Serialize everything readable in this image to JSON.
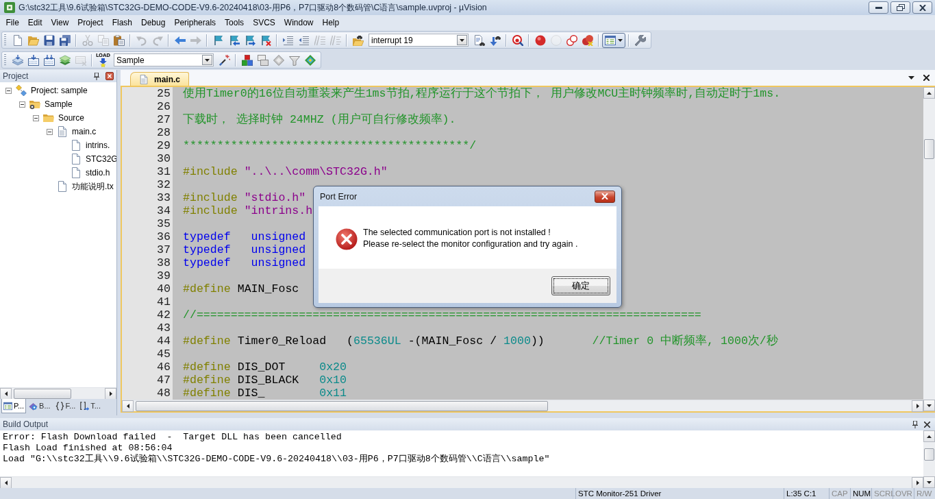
{
  "window": {
    "title": "G:\\stc32工具\\9.6试验箱\\STC32G-DEMO-CODE-V9.6-20240418\\03-用P6，P7口驱动8个数码管\\C语言\\sample.uvproj - µVision"
  },
  "menu": [
    "File",
    "Edit",
    "View",
    "Project",
    "Flash",
    "Debug",
    "Peripherals",
    "Tools",
    "SVCS",
    "Window",
    "Help"
  ],
  "toolbars": [
    {
      "items": [
        {
          "kind": "button",
          "disabled": false,
          "pressed": false
        },
        {
          "kind": "button",
          "disabled": false,
          "pressed": false
        },
        {
          "kind": "button",
          "disabled": false,
          "pressed": false
        },
        {
          "kind": "button",
          "disabled": false,
          "pressed": false
        },
        {
          "kind": "separator"
        },
        {
          "kind": "button",
          "disabled": true,
          "pressed": false
        },
        {
          "kind": "button",
          "disabled": true,
          "pressed": false
        },
        {
          "kind": "button",
          "disabled": false,
          "pressed": false
        },
        {
          "kind": "separator"
        },
        {
          "kind": "button",
          "disabled": true,
          "pressed": false
        },
        {
          "kind": "button",
          "disabled": true,
          "pressed": false
        },
        {
          "kind": "separator"
        },
        {
          "kind": "button",
          "disabled": false,
          "pressed": false
        },
        {
          "kind": "button",
          "disabled": true,
          "pressed": false
        },
        {
          "kind": "separator"
        },
        {
          "kind": "button",
          "disabled": false,
          "pressed": false
        },
        {
          "kind": "button",
          "disabled": false,
          "pressed": false
        },
        {
          "kind": "button",
          "disabled": false,
          "pressed": false
        },
        {
          "kind": "button",
          "disabled": false,
          "pressed": false
        },
        {
          "kind": "separator"
        },
        {
          "kind": "button",
          "disabled": false,
          "pressed": false
        },
        {
          "kind": "button",
          "disabled": false,
          "pressed": false
        },
        {
          "kind": "button",
          "disabled": true,
          "pressed": false
        },
        {
          "kind": "button",
          "disabled": true,
          "pressed": false
        },
        {
          "kind": "separator"
        },
        {
          "kind": "button",
          "disabled": false,
          "pressed": false
        },
        {
          "kind": "combo",
          "value": "interrupt 19"
        },
        {
          "kind": "button",
          "disabled": false,
          "pressed": false
        },
        {
          "kind": "button",
          "disabled": false,
          "pressed": false
        },
        {
          "kind": "separator"
        },
        {
          "kind": "button",
          "disabled": false,
          "pressed": false
        },
        {
          "kind": "separator"
        },
        {
          "kind": "button",
          "disabled": false,
          "pressed": false
        },
        {
          "kind": "button",
          "disabled": true,
          "pressed": false
        },
        {
          "kind": "button",
          "disabled": false,
          "pressed": false
        },
        {
          "kind": "button",
          "disabled": false,
          "pressed": false
        },
        {
          "kind": "separator"
        },
        {
          "kind": "dropdown",
          "disabled": false,
          "pressed": true
        },
        {
          "kind": "separator"
        },
        {
          "kind": "button",
          "disabled": false,
          "pressed": false
        }
      ]
    },
    {
      "items": [
        {
          "kind": "button",
          "disabled": false,
          "pressed": false
        },
        {
          "kind": "button",
          "disabled": false,
          "pressed": false
        },
        {
          "kind": "button",
          "disabled": false,
          "pressed": false
        },
        {
          "kind": "button",
          "disabled": false,
          "pressed": false
        },
        {
          "kind": "button",
          "disabled": true,
          "pressed": false
        },
        {
          "kind": "separator"
        },
        {
          "kind": "button",
          "disabled": false,
          "pressed": false,
          "label": "LOAD"
        },
        {
          "kind": "combo",
          "value": "Sample"
        },
        {
          "kind": "button",
          "disabled": false,
          "pressed": false
        },
        {
          "kind": "separator"
        },
        {
          "kind": "button",
          "disabled": false,
          "pressed": false
        },
        {
          "kind": "button",
          "disabled": false,
          "pressed": false
        },
        {
          "kind": "button",
          "disabled": false,
          "pressed": false
        },
        {
          "kind": "button",
          "disabled": false,
          "pressed": false
        },
        {
          "kind": "button",
          "disabled": false,
          "pressed": false
        }
      ]
    }
  ],
  "project_panel": {
    "title": "Project",
    "tree": [
      {
        "label": "Project: sample",
        "kind": "project",
        "expanded": true,
        "children": [
          {
            "label": "Sample",
            "kind": "target",
            "expanded": true,
            "children": [
              {
                "label": "Source",
                "kind": "group",
                "expanded": true,
                "children": [
                  {
                    "label": "main.c",
                    "kind": "source",
                    "expanded": true,
                    "children": [
                      {
                        "label": "intrins.",
                        "kind": "header"
                      },
                      {
                        "label": "STC32G",
                        "kind": "header"
                      },
                      {
                        "label": "stdio.h",
                        "kind": "header"
                      }
                    ]
                  },
                  {
                    "label": "功能说明.tx",
                    "kind": "text"
                  }
                ]
              }
            ]
          }
        ]
      }
    ],
    "tabs": [
      {
        "label": "P...",
        "selected": true
      },
      {
        "label": "B...",
        "selected": false
      },
      {
        "label": "F...",
        "selected": false
      },
      {
        "label": "T...",
        "selected": false
      }
    ]
  },
  "editor": {
    "tabs": [
      {
        "label": "main.c",
        "selected": true
      }
    ],
    "lines": [
      {
        "number": "25",
        "tokens": [
          {
            "kind": "comment",
            "text": "使用Timer0的16位自动重装来产生1ms节拍,程序运行于这个节拍下， 用户修改MCU主时钟频率时,自动定时于1ms."
          }
        ]
      },
      {
        "number": "26"
      },
      {
        "number": "27",
        "tokens": [
          {
            "kind": "comment",
            "text": "下载时， 选择时钟 24MHZ (用户可自行修改频率)."
          }
        ]
      },
      {
        "number": "28"
      },
      {
        "number": "29",
        "tokens": [
          {
            "kind": "comment",
            "text": "******************************************/"
          }
        ]
      },
      {
        "number": "30"
      },
      {
        "number": "31",
        "tokens": [
          {
            "kind": "preprocessor",
            "text": "#include "
          },
          {
            "kind": "string",
            "text": "\"..\\..\\comm\\STC32G.h\""
          }
        ]
      },
      {
        "number": "32"
      },
      {
        "number": "33",
        "tokens": [
          {
            "kind": "preprocessor",
            "text": "#include "
          },
          {
            "kind": "string",
            "text": "\"stdio.h\""
          }
        ]
      },
      {
        "number": "34",
        "tokens": [
          {
            "kind": "preprocessor",
            "text": "#include "
          },
          {
            "kind": "string",
            "text": "\"intrins.h"
          }
        ]
      },
      {
        "number": "35"
      },
      {
        "number": "36",
        "tokens": [
          {
            "kind": "keyword",
            "text": "typedef   unsigned"
          }
        ]
      },
      {
        "number": "37",
        "tokens": [
          {
            "kind": "keyword",
            "text": "typedef   unsigned"
          }
        ]
      },
      {
        "number": "38",
        "tokens": [
          {
            "kind": "keyword",
            "text": "typedef   unsigned"
          }
        ]
      },
      {
        "number": "39"
      },
      {
        "number": "40",
        "tokens": [
          {
            "kind": "preprocessor",
            "text": "#define"
          },
          {
            "kind": "plain",
            "text": " MAIN_Fosc"
          }
        ]
      },
      {
        "number": "41"
      },
      {
        "number": "42",
        "tokens": [
          {
            "kind": "comment",
            "text": "//=========================================================================="
          }
        ]
      },
      {
        "number": "43"
      },
      {
        "number": "44",
        "tokens": [
          {
            "kind": "preprocessor",
            "text": "#define"
          },
          {
            "kind": "plain",
            "text": " Timer0_Reload   ("
          },
          {
            "kind": "number",
            "text": "65536UL"
          },
          {
            "kind": "plain",
            "text": " -(MAIN_Fosc / "
          },
          {
            "kind": "number",
            "text": "1000"
          },
          {
            "kind": "plain",
            "text": "))       "
          },
          {
            "kind": "comment",
            "text": "//Timer 0 中断频率, 1000次/秒"
          }
        ]
      },
      {
        "number": "45"
      },
      {
        "number": "46",
        "tokens": [
          {
            "kind": "preprocessor",
            "text": "#define"
          },
          {
            "kind": "plain",
            "text": " DIS_DOT     "
          },
          {
            "kind": "number",
            "text": "0x20"
          }
        ]
      },
      {
        "number": "47",
        "tokens": [
          {
            "kind": "preprocessor",
            "text": "#define"
          },
          {
            "kind": "plain",
            "text": " DIS_BLACK   "
          },
          {
            "kind": "number",
            "text": "0x10"
          }
        ]
      },
      {
        "number": "48",
        "tokens": [
          {
            "kind": "preprocessor",
            "text": "#define"
          },
          {
            "kind": "plain",
            "text": " DIS_        "
          },
          {
            "kind": "number",
            "text": "0x11"
          }
        ]
      }
    ]
  },
  "dialog": {
    "title": "Port Error",
    "message": [
      "The selected communication port is not installed !",
      "Please re-select the monitor configuration and try again ."
    ],
    "buttons": [
      {
        "label": "确定",
        "focused": true
      }
    ]
  },
  "build_output": {
    "title": "Build Output",
    "lines": [
      "Error: Flash Download failed  -  Target DLL has been cancelled",
      "Flash Load finished at 08:56:04",
      "Load \"G:\\\\stc32工具\\\\9.6试验箱\\\\STC32G-DEMO-CODE-V9.6-20240418\\\\03-用P6，P7口驱动8个数码管\\\\C语言\\\\sample\""
    ]
  },
  "status_bar": {
    "driver": "STC Monitor-251 Driver",
    "position": "L:35 C:1",
    "indicators": [
      {
        "label": "CAP",
        "on": false
      },
      {
        "label": "NUM",
        "on": true
      },
      {
        "label": "SCRL",
        "on": false
      },
      {
        "label": "OVR",
        "on": false
      },
      {
        "label": "R/W",
        "on": false
      }
    ]
  }
}
